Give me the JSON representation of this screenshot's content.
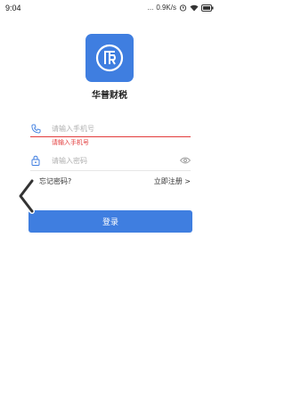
{
  "status_bar": {
    "time": "9:04",
    "dots": "...",
    "speed": "0.9K/s"
  },
  "app": {
    "name": "华普财税",
    "logo_color": "#3f7ee0"
  },
  "phone_field": {
    "placeholder": "请输入手机号",
    "value": "",
    "error": "请输入手机号",
    "icon": "phone-icon"
  },
  "password_field": {
    "placeholder": "请输入密码",
    "value": "",
    "icon": "lock-icon",
    "toggle_icon": "eye-icon"
  },
  "links": {
    "forgot": "忘记密码?",
    "register": "立即注册 >"
  },
  "login_button": {
    "label": "登录",
    "color": "#3f7ee0"
  },
  "colors": {
    "error": "#e23b3b",
    "accent": "#3f7ee0"
  }
}
